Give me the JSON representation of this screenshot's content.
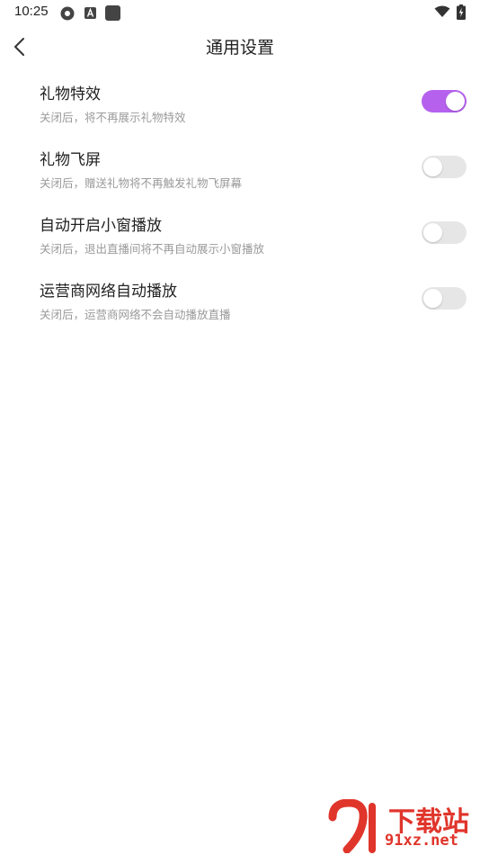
{
  "status": {
    "time": "10:25"
  },
  "header": {
    "title": "通用设置"
  },
  "settings": [
    {
      "title": "礼物特效",
      "desc": "关闭后，将不再展示礼物特效",
      "enabled": true
    },
    {
      "title": "礼物飞屏",
      "desc": "关闭后，赠送礼物将不再触发礼物飞屏幕",
      "enabled": false
    },
    {
      "title": "自动开启小窗播放",
      "desc": "关闭后，退出直播间将不再自动展示小窗播放",
      "enabled": false
    },
    {
      "title": "运营商网络自动播放",
      "desc": "关闭后，运营商网络不会自动播放直播",
      "enabled": false
    }
  ],
  "colors": {
    "accent": "#b561ee",
    "toggle_off": "#e6e6e6",
    "watermark": "#e0352b"
  },
  "watermark": {
    "cn": "下载站",
    "url": "91xz.net"
  }
}
